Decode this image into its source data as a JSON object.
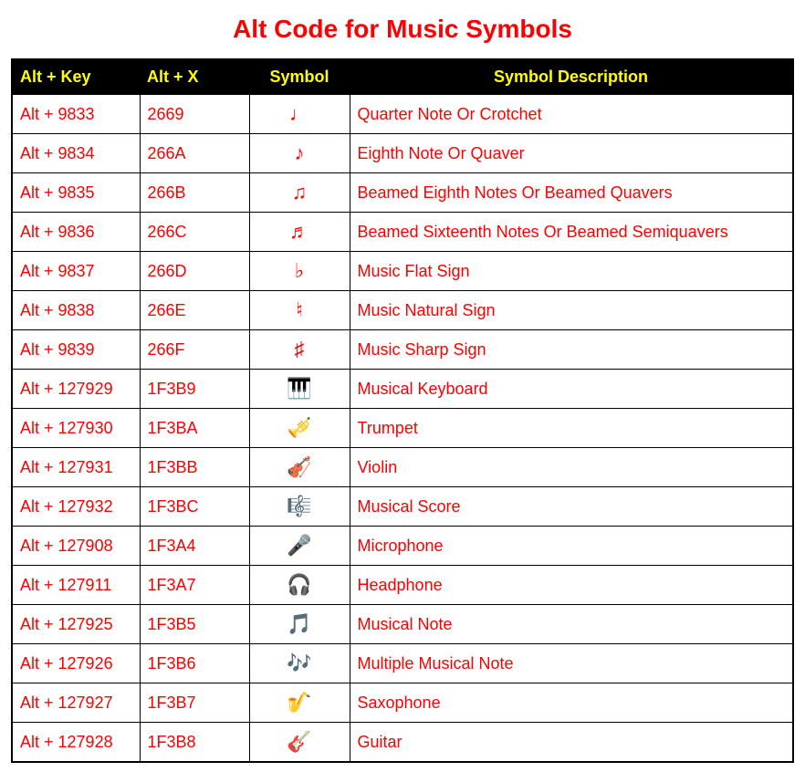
{
  "title": "Alt Code for Music Symbols",
  "headers": {
    "altkey": "Alt + Key",
    "altx": "Alt + X",
    "symbol": "Symbol",
    "description": "Symbol Description"
  },
  "rows": [
    {
      "altkey": "Alt + 9833",
      "altx": "2669",
      "symbol": "♩",
      "description": "Quarter Note Or Crotchet"
    },
    {
      "altkey": "Alt + 9834",
      "altx": "266A",
      "symbol": "♪",
      "description": "Eighth Note Or Quaver"
    },
    {
      "altkey": "Alt + 9835",
      "altx": "266B",
      "symbol": "♫",
      "description": "Beamed Eighth Notes Or Beamed Quavers"
    },
    {
      "altkey": "Alt + 9836",
      "altx": "266C",
      "symbol": "♬",
      "description": "Beamed Sixteenth Notes Or Beamed Semiquavers"
    },
    {
      "altkey": "Alt + 9837",
      "altx": "266D",
      "symbol": "♭",
      "description": "Music Flat Sign"
    },
    {
      "altkey": "Alt + 9838",
      "altx": "266E",
      "symbol": "♮",
      "description": "Music Natural Sign"
    },
    {
      "altkey": "Alt + 9839",
      "altx": "266F",
      "symbol": "♯",
      "description": "Music Sharp Sign"
    },
    {
      "altkey": "Alt + 127929",
      "altx": "1F3B9",
      "symbol": "🎹",
      "description": "Musical Keyboard"
    },
    {
      "altkey": "Alt + 127930",
      "altx": "1F3BA",
      "symbol": "🎺",
      "description": "Trumpet"
    },
    {
      "altkey": "Alt + 127931",
      "altx": "1F3BB",
      "symbol": "🎻",
      "description": "Violin"
    },
    {
      "altkey": "Alt + 127932",
      "altx": "1F3BC",
      "symbol": "🎼",
      "description": "Musical Score"
    },
    {
      "altkey": "Alt + 127908",
      "altx": "1F3A4",
      "symbol": "🎤",
      "description": "Microphone"
    },
    {
      "altkey": "Alt + 127911",
      "altx": "1F3A7",
      "symbol": "🎧",
      "description": "Headphone"
    },
    {
      "altkey": "Alt + 127925",
      "altx": "1F3B5",
      "symbol": "🎵",
      "description": "Musical Note"
    },
    {
      "altkey": "Alt + 127926",
      "altx": "1F3B6",
      "symbol": "🎶",
      "description": "Multiple Musical Note"
    },
    {
      "altkey": "Alt + 127927",
      "altx": "1F3B7",
      "symbol": "🎷",
      "description": "Saxophone"
    },
    {
      "altkey": "Alt + 127928",
      "altx": "1F3B8",
      "symbol": "🎸",
      "description": "Guitar"
    }
  ]
}
